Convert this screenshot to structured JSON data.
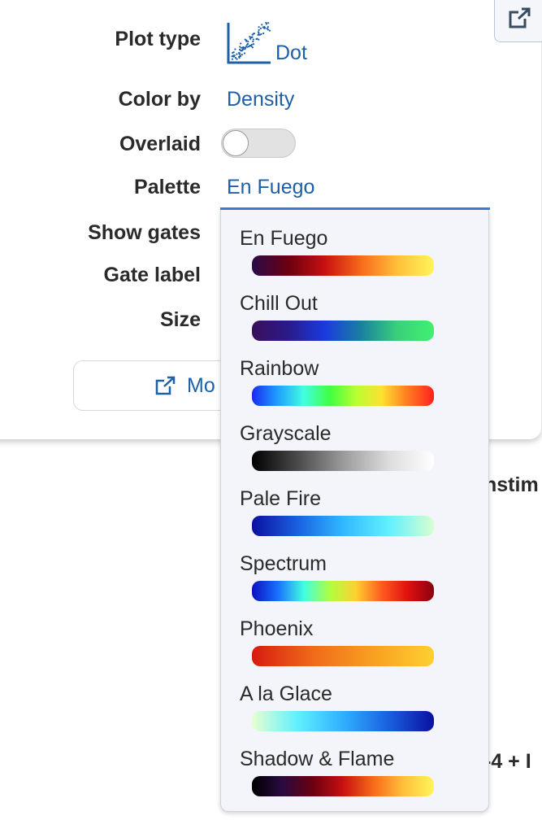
{
  "settings": {
    "plot_type": {
      "label": "Plot type",
      "value": "Dot",
      "icon": "dot-plot-icon"
    },
    "color_by": {
      "label": "Color by",
      "value": "Density"
    },
    "overlaid": {
      "label": "Overlaid",
      "on": false
    },
    "palette": {
      "label": "Palette",
      "value": "En Fuego"
    },
    "show_gates": {
      "label": "Show gates"
    },
    "gate_label": {
      "label": "Gate label"
    },
    "size": {
      "label": "Size"
    }
  },
  "more_button": {
    "label": "Mo",
    "icon": "external-link-icon"
  },
  "popout_button": {
    "icon": "external-link-icon"
  },
  "background_text": {
    "line1": "nstim",
    "line2": "-4 + I"
  },
  "accent_color": "#1f5fa8",
  "palette_options": [
    {
      "name": "En Fuego",
      "colors": [
        "#2a0a4a",
        "#6a0010",
        "#c81010",
        "#f86a1a",
        "#ffc03a",
        "#fff55a"
      ]
    },
    {
      "name": "Chill Out",
      "colors": [
        "#3a0f5a",
        "#2a1a8a",
        "#1a3ae0",
        "#1a80a0",
        "#3ad07a",
        "#40f070"
      ]
    },
    {
      "name": "Rainbow",
      "colors": [
        "#1a2af0",
        "#20a0ff",
        "#40ffe0",
        "#40ff40",
        "#b8ff30",
        "#ffe030",
        "#ff7a20",
        "#ff2020"
      ]
    },
    {
      "name": "Grayscale",
      "colors": [
        "#000000",
        "#4a4a4a",
        "#9a9a9a",
        "#dcdcdc",
        "#ffffff"
      ]
    },
    {
      "name": "Pale Fire",
      "colors": [
        "#0a10a0",
        "#1a60e0",
        "#30b8ff",
        "#60f0ff",
        "#d8ffd0"
      ]
    },
    {
      "name": "Spectrum",
      "colors": [
        "#0a10c0",
        "#1a70ff",
        "#40ffe0",
        "#b0ff40",
        "#ffd030",
        "#ff5a20",
        "#e01010",
        "#8a0010"
      ]
    },
    {
      "name": "Phoenix",
      "colors": [
        "#d81a10",
        "#f06a1a",
        "#f8a020",
        "#ffd030"
      ]
    },
    {
      "name": "A la Glace",
      "colors": [
        "#e8ffd0",
        "#60f0ff",
        "#30b0ff",
        "#1a60e0",
        "#0a10a0"
      ]
    },
    {
      "name": "Shadow & Flame",
      "colors": [
        "#000000",
        "#2a0a40",
        "#6a0010",
        "#c81010",
        "#f86a1a",
        "#ffc03a",
        "#fff55a"
      ]
    }
  ]
}
